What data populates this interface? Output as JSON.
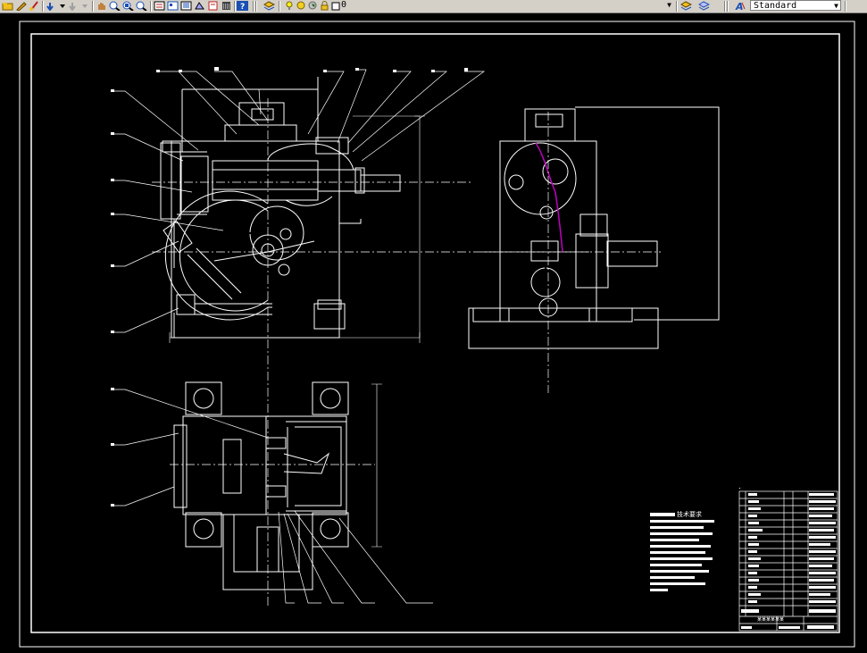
{
  "toolbar": {
    "layer_value": "0",
    "text_style_value": "Standard",
    "colors": {
      "bg": "#d4d0c8",
      "icon_blue": "#1a4fb5",
      "icon_yellow": "#f0c020",
      "icon_red": "#c02020"
    }
  },
  "drawing": {
    "tech_req_title": "技术要求",
    "title_block_name": "某某某某某某",
    "colors": {
      "lines": "#ffffff",
      "magenta": "#c000c0",
      "background": "#000000"
    }
  }
}
